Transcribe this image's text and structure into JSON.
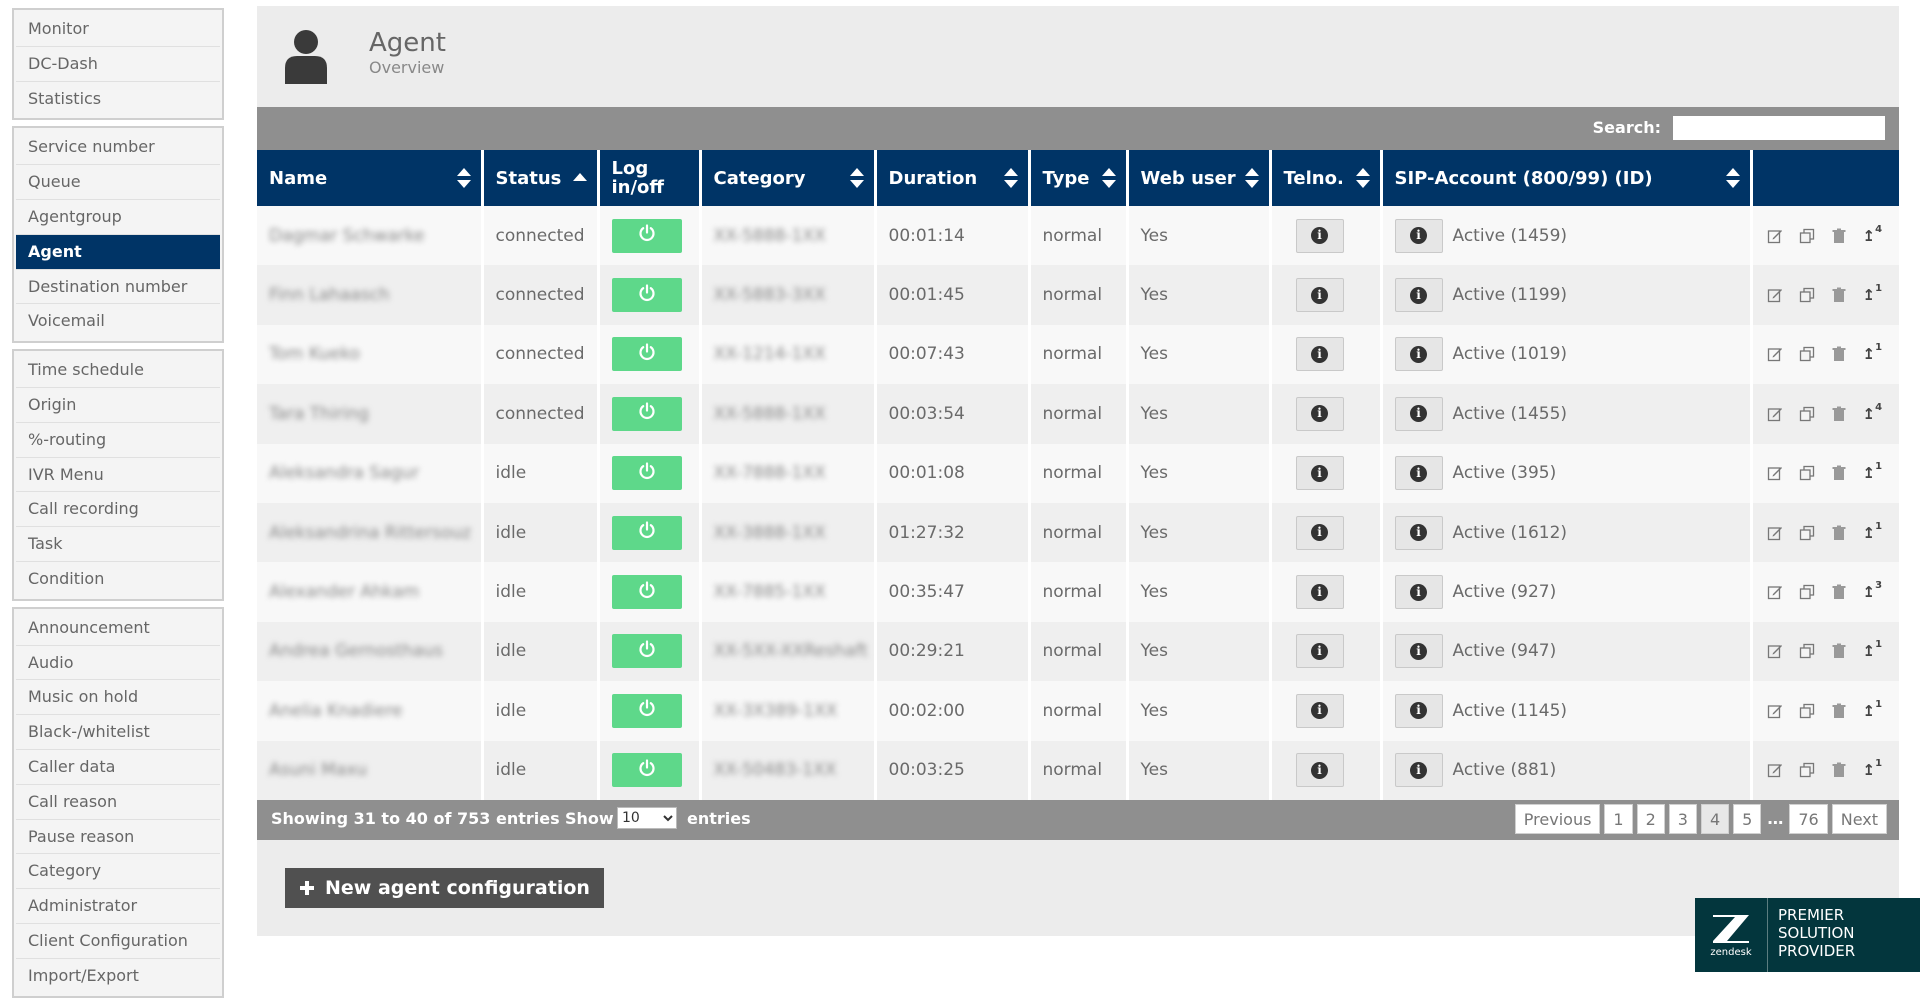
{
  "sidebar": {
    "groups": [
      [
        "Monitor",
        "DC-Dash",
        "Statistics"
      ],
      [
        "Service number",
        "Queue",
        "Agentgroup",
        "Agent",
        "Destination number",
        "Voicemail"
      ],
      [
        "Time schedule",
        "Origin",
        "%-routing",
        "IVR Menu",
        "Call recording",
        "Task",
        "Condition"
      ],
      [
        "Announcement",
        "Audio",
        "Music on hold",
        "Black-/whitelist",
        "Caller data",
        "Call reason",
        "Pause reason",
        "Category",
        "Administrator",
        "Client Configuration",
        "Import/Export"
      ]
    ],
    "active": "Agent"
  },
  "header": {
    "title": "Agent",
    "subtitle": "Overview",
    "icon": "user-icon"
  },
  "search": {
    "label": "Search:",
    "value": ""
  },
  "table": {
    "columns": [
      "Name",
      "Status",
      "Log in/off",
      "Category",
      "Duration",
      "Type",
      "Web user",
      "Telno.",
      "SIP-Account (800/99) (ID)",
      ""
    ],
    "rows": [
      {
        "name": "Dagmar Schwarke",
        "status": "connected",
        "category": "XX-5888-1XX",
        "duration": "00:01:14",
        "type": "normal",
        "web_user": "Yes",
        "sip": "Active (1459)",
        "up": "4"
      },
      {
        "name": "Finn Lahaasch",
        "status": "connected",
        "category": "XX-5883-3XX",
        "duration": "00:01:45",
        "type": "normal",
        "web_user": "Yes",
        "sip": "Active (1199)",
        "up": "1"
      },
      {
        "name": "Tom Kueko",
        "status": "connected",
        "category": "XX-1214-1XX",
        "duration": "00:07:43",
        "type": "normal",
        "web_user": "Yes",
        "sip": "Active (1019)",
        "up": "1"
      },
      {
        "name": "Tara Thiring",
        "status": "connected",
        "category": "XX-5888-1XX",
        "duration": "00:03:54",
        "type": "normal",
        "web_user": "Yes",
        "sip": "Active (1455)",
        "up": "4"
      },
      {
        "name": "Aleksandra Sagur",
        "status": "idle",
        "category": "XX-7888-1XX",
        "duration": "00:01:08",
        "type": "normal",
        "web_user": "Yes",
        "sip": "Active (395)",
        "up": "1"
      },
      {
        "name": "Aleksandrina Rittersouz",
        "status": "idle",
        "category": "XX-3888-1XX",
        "duration": "01:27:32",
        "type": "normal",
        "web_user": "Yes",
        "sip": "Active (1612)",
        "up": "1"
      },
      {
        "name": "Alexander Ahkam",
        "status": "idle",
        "category": "XX-7885-1XX",
        "duration": "00:35:47",
        "type": "normal",
        "web_user": "Yes",
        "sip": "Active (927)",
        "up": "3"
      },
      {
        "name": "Andrea Gernosthaus",
        "status": "idle",
        "category": "XX-5XX-XXReshaft",
        "duration": "00:29:21",
        "type": "normal",
        "web_user": "Yes",
        "sip": "Active (947)",
        "up": "1"
      },
      {
        "name": "Anelia Knadiere",
        "status": "idle",
        "category": "XX-3X389-1XX",
        "duration": "00:02:00",
        "type": "normal",
        "web_user": "Yes",
        "sip": "Active (1145)",
        "up": "1"
      },
      {
        "name": "Asuni Maxu",
        "status": "idle",
        "category": "XX-50483-1XX",
        "duration": "00:03:25",
        "type": "normal",
        "web_user": "Yes",
        "sip": "Active (881)",
        "up": "1"
      }
    ]
  },
  "footer": {
    "showing": "Showing 31 to 40 of 753 entries",
    "show_label": "Show",
    "length_value": "10",
    "entries_label": "entries",
    "pagination": [
      "Previous",
      "1",
      "2",
      "3",
      "4",
      "5",
      "…",
      "76",
      "Next"
    ],
    "current_page": "4"
  },
  "new_button": {
    "label": "New agent configuration",
    "icon": "plus-icon"
  },
  "badge": {
    "logo_text": "zendesk",
    "lines": [
      "PREMIER",
      "SOLUTION",
      "PROVIDER"
    ]
  },
  "colors": {
    "primary": "#003466",
    "power": "#5ed88a",
    "bar": "#8f8f8f",
    "zendesk": "#03363d"
  }
}
